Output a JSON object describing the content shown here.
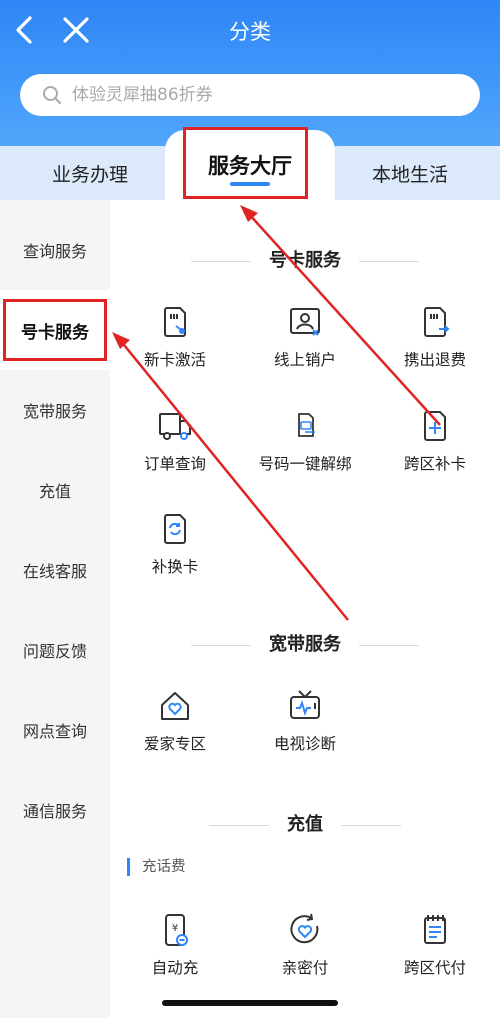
{
  "header": {
    "title": "分类",
    "back_icon": "chevron-left-icon",
    "close_icon": "close-icon"
  },
  "search": {
    "placeholder": "体验灵犀抽86折券",
    "icon": "search-icon"
  },
  "tabs": [
    {
      "label": "业务办理",
      "active": false
    },
    {
      "label": "服务大厅",
      "active": true
    },
    {
      "label": "本地生活",
      "active": false
    }
  ],
  "sidebar": {
    "items": [
      {
        "label": "查询服务",
        "active": false
      },
      {
        "label": "号卡服务",
        "active": true
      },
      {
        "label": "宽带服务",
        "active": false
      },
      {
        "label": "充值",
        "active": false
      },
      {
        "label": "在线客服",
        "active": false
      },
      {
        "label": "问题反馈",
        "active": false
      },
      {
        "label": "网点查询",
        "active": false
      },
      {
        "label": "通信服务",
        "active": false
      }
    ]
  },
  "sections": {
    "card": {
      "title": "号卡服务",
      "items": [
        {
          "label": "新卡激活",
          "icon": "sim-activate-icon"
        },
        {
          "label": "线上销户",
          "icon": "id-card-cancel-icon"
        },
        {
          "label": "携出退费",
          "icon": "sim-port-out-icon"
        },
        {
          "label": "订单查询",
          "icon": "delivery-truck-icon"
        },
        {
          "label": "号码一键解绑",
          "icon": "number-unbind-icon"
        },
        {
          "label": "跨区补卡",
          "icon": "card-reissue-icon"
        },
        {
          "label": "补换卡",
          "icon": "sim-replace-icon"
        }
      ]
    },
    "broadband": {
      "title": "宽带服务",
      "items": [
        {
          "label": "爱家专区",
          "icon": "home-heart-icon"
        },
        {
          "label": "电视诊断",
          "icon": "tv-diagnose-icon"
        }
      ]
    },
    "recharge": {
      "title": "充值",
      "subhead": "充话费",
      "items": [
        {
          "label": "自动充",
          "icon": "auto-recharge-icon"
        },
        {
          "label": "亲密付",
          "icon": "heart-pay-icon"
        },
        {
          "label": "跨区代付",
          "icon": "bill-pay-icon"
        }
      ]
    }
  },
  "colors": {
    "accent": "#2f86f6",
    "annotation": "#e02424",
    "sidebar_bg": "#f4f5f7"
  }
}
